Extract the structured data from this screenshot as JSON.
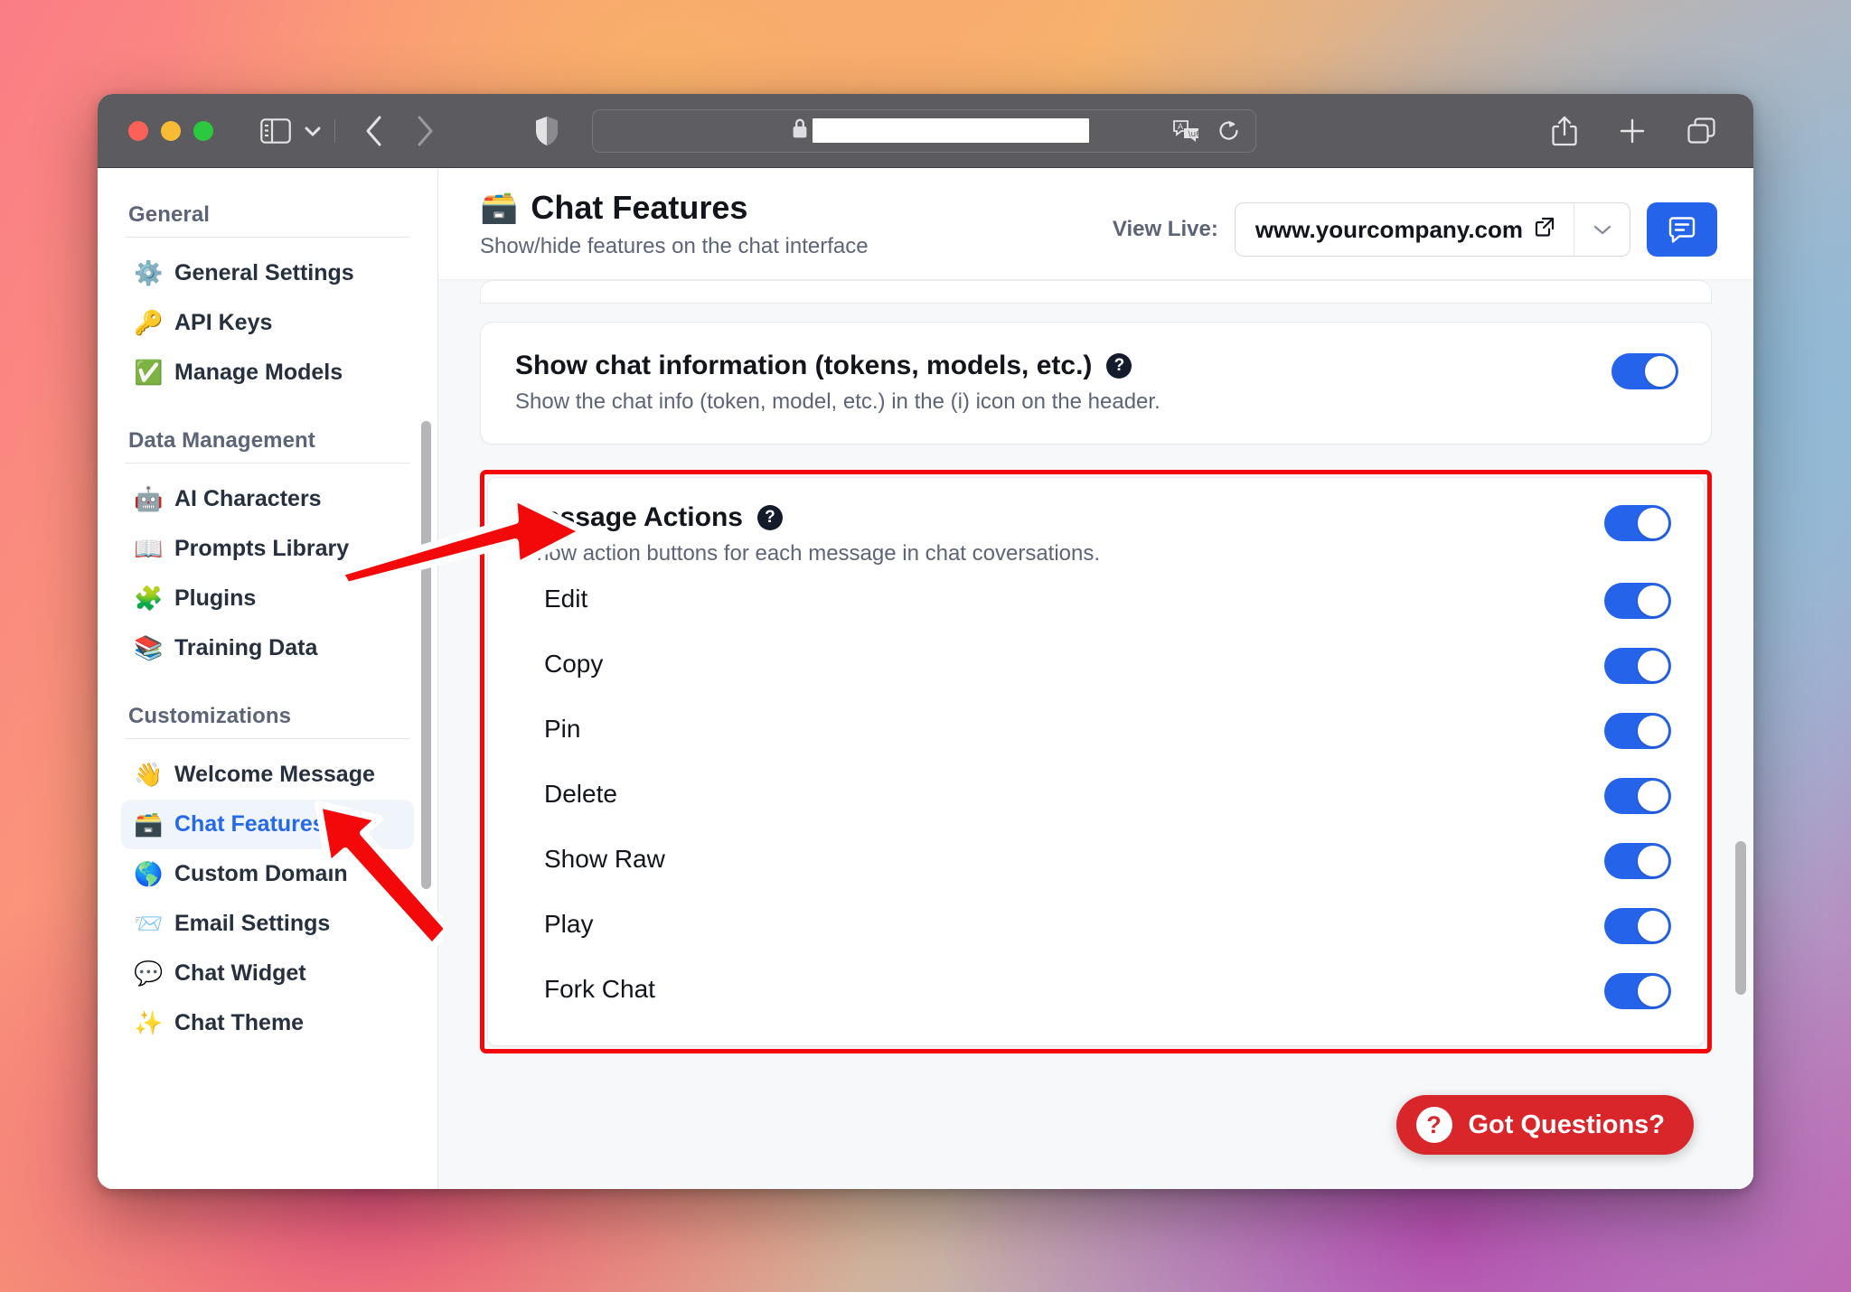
{
  "browser": {
    "traffic_lights": [
      "close-red",
      "minimize-yellow",
      "zoom-green"
    ],
    "icons": {
      "sidebar_toggle": "sidebar-icon",
      "sidebar_chevron": "chevron-down-icon",
      "back": "chevron-left-icon",
      "forward": "chevron-right-icon",
      "shield": "shield-icon",
      "lock": "lock-icon",
      "translate": "translate-icon",
      "reload": "reload-icon",
      "share": "share-icon",
      "new_tab": "plus-icon",
      "tab_overview": "tab-overview-icon"
    },
    "address_value": "",
    "address_placeholder": ""
  },
  "sidebar": {
    "sections": [
      {
        "heading": "General",
        "items": [
          {
            "emoji": "⚙️",
            "label": "General Settings",
            "active": false
          },
          {
            "emoji": "🔑",
            "label": "API Keys",
            "active": false
          },
          {
            "emoji": "✅",
            "label": "Manage Models",
            "active": false
          }
        ]
      },
      {
        "heading": "Data Management",
        "items": [
          {
            "emoji": "🤖",
            "label": "AI Characters",
            "active": false
          },
          {
            "emoji": "📖",
            "label": "Prompts Library",
            "active": false
          },
          {
            "emoji": "🧩",
            "label": "Plugins",
            "active": false
          },
          {
            "emoji": "📚",
            "label": "Training Data",
            "active": false
          }
        ]
      },
      {
        "heading": "Customizations",
        "items": [
          {
            "emoji": "👋",
            "label": "Welcome Message",
            "active": false
          },
          {
            "emoji": "🗃️",
            "label": "Chat Features",
            "active": true
          },
          {
            "emoji": "🌎",
            "label": "Custom Domain",
            "active": false
          },
          {
            "emoji": "📨",
            "label": "Email Settings",
            "active": false
          },
          {
            "emoji": "💬",
            "label": "Chat Widget",
            "active": false
          },
          {
            "emoji": "✨",
            "label": "Chat Theme",
            "active": false
          }
        ]
      }
    ]
  },
  "header": {
    "emoji": "🗃️",
    "title": "Chat Features",
    "subtitle": "Show/hide features on the chat interface",
    "view_live_label": "View Live:",
    "domain": "www.yourcompany.com",
    "external_link_icon": "external-link-icon",
    "caret_icon": "chevron-down-icon",
    "chat_button_icon": "chat-bubble-icon"
  },
  "settings": {
    "chat_information": {
      "title": "Show chat information (tokens, models, etc.)",
      "help": "?",
      "description": "Show the chat info (token, model, etc.) in the (i) icon on the header.",
      "enabled": true
    },
    "message_actions": {
      "title": "Message Actions",
      "help": "?",
      "description": "Show action buttons for each message in chat coversations.",
      "enabled": true,
      "sub_items": [
        {
          "label": "Edit",
          "enabled": true
        },
        {
          "label": "Copy",
          "enabled": true
        },
        {
          "label": "Pin",
          "enabled": true
        },
        {
          "label": "Delete",
          "enabled": true
        },
        {
          "label": "Show Raw",
          "enabled": true
        },
        {
          "label": "Play",
          "enabled": true
        },
        {
          "label": "Fork Chat",
          "enabled": true
        }
      ]
    }
  },
  "support": {
    "icon": "question-mark-icon",
    "label": "Got Questions?"
  },
  "annotations": {
    "highlight_color": "#F4090A",
    "arrow_to_highlight": "red-arrow-right",
    "arrow_to_sidebar_item": "red-arrow-up-left"
  },
  "colors": {
    "accent_blue": "#2563EB",
    "toggle_on": "#2563EB",
    "highlight_red": "#F4090A",
    "support_red": "#D9262A",
    "sidebar_active_text": "#2569E8"
  }
}
